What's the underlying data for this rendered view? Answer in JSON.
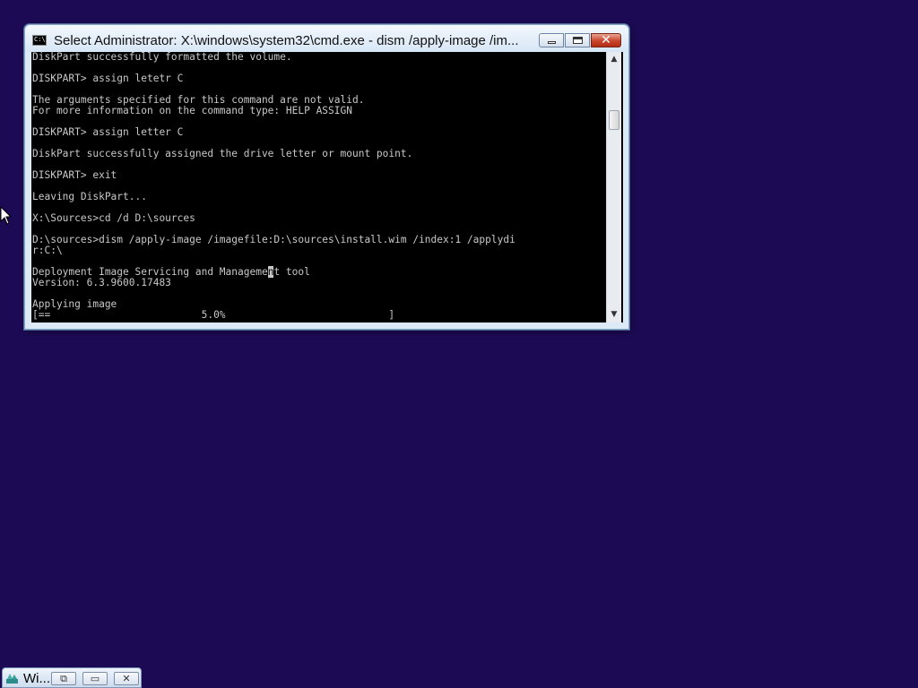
{
  "window": {
    "title": "Select Administrator: X:\\windows\\system32\\cmd.exe - dism  /apply-image /im...",
    "icon": "cmd-console-icon",
    "icon_text": "C:\\",
    "buttons": {
      "minimize": "minimize-icon",
      "maximize": "maximize-icon",
      "close_glyph": "✕"
    }
  },
  "console": {
    "lines": [
      "DiskPart successfully formatted the volume.",
      "",
      "DISKPART> assign letetr C",
      "",
      "The arguments specified for this command are not valid.",
      "For more information on the command type: HELP ASSIGN",
      "",
      "DISKPART> assign letter C",
      "",
      "DiskPart successfully assigned the drive letter or mount point.",
      "",
      "DISKPART> exit",
      "",
      "Leaving DiskPart...",
      "",
      "X:\\Sources>cd /d D:\\sources",
      "",
      "D:\\sources>dism /apply-image /imagefile:D:\\sources\\install.wim /index:1 /applydi",
      "r:C:\\",
      "",
      "Deployment Image Servicing and Management tool",
      "Version: 6.3.9600.17483",
      "",
      "Applying image",
      "[==                         5.0%                           ]"
    ],
    "cursor_line": 20,
    "cursor_col": 39,
    "progress_percent": 5.0
  },
  "scrollbar": {
    "up_arrow": "▲",
    "down_arrow": "▼"
  },
  "minimized_task": {
    "label": "Wi...",
    "restore_glyph": "⧉",
    "maximize_glyph": "▭",
    "close_glyph": "✕"
  },
  "colors": {
    "desktop": "#1d0a55",
    "console_bg": "#000000",
    "console_fg": "#c8c8c8",
    "close_button": "#c8452c"
  }
}
